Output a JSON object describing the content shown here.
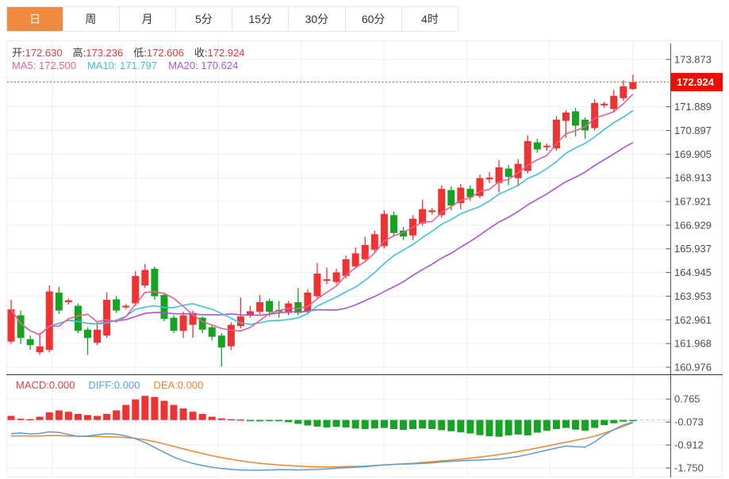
{
  "tabs": [
    {
      "label": "日",
      "selected": true
    },
    {
      "label": "周",
      "selected": false
    },
    {
      "label": "月",
      "selected": false
    },
    {
      "label": "5分",
      "selected": false
    },
    {
      "label": "15分",
      "selected": false
    },
    {
      "label": "30分",
      "selected": false
    },
    {
      "label": "60分",
      "selected": false
    },
    {
      "label": "4时",
      "selected": false
    }
  ],
  "main_overlay": {
    "ohlc": [
      {
        "label": "开:",
        "value": "172.630"
      },
      {
        "label": "高:",
        "value": "173.236"
      },
      {
        "label": "低:",
        "value": "172.606"
      },
      {
        "label": "收:",
        "value": "172.924"
      }
    ],
    "ma": [
      "MA5: 172.500",
      "MA10: 171.797",
      "MA20: 170.624"
    ]
  },
  "macd_overlay": [
    "MACD:0.000",
    "DIFF:0.000",
    "DEA:0.000"
  ],
  "price_tag": "172.924",
  "colors": {
    "up": "#ef3232",
    "down": "#16a321",
    "ma5": "#e8618f",
    "ma10": "#3cc3da",
    "ma20": "#ab53d5",
    "diff": "#5b9bd5",
    "dea": "#f0862b",
    "tag_bg": "#eb0f00",
    "tab_selected": "#f08a3e",
    "grid": "#e9eef5",
    "axis": "#555555",
    "dotted_price_line": "#f04040",
    "macd_zero_dashed": "#9fd0ef"
  },
  "chart_data": {
    "type": "candlestick+macd",
    "timeframe_selected": "日",
    "current_price": 172.924,
    "price_axis": {
      "ticks": [
        173.873,
        171.889,
        170.897,
        169.905,
        168.913,
        167.921,
        166.929,
        165.937,
        164.945,
        163.953,
        162.961,
        161.968,
        160.976
      ]
    },
    "macd_axis": {
      "ticks": [
        0.765,
        -0.073,
        -0.912,
        -1.75
      ]
    },
    "candle_format": [
      "open",
      "close",
      "high",
      "low"
    ],
    "candles": [
      [
        162.05,
        163.4,
        163.8,
        161.95
      ],
      [
        163.15,
        162.2,
        163.35,
        161.95
      ],
      [
        162.15,
        161.9,
        162.3,
        161.7
      ],
      [
        161.6,
        161.85,
        162.4,
        161.5
      ],
      [
        161.7,
        164.15,
        164.4,
        161.6
      ],
      [
        164.1,
        163.35,
        164.35,
        163.2
      ],
      [
        163.7,
        163.78,
        163.85,
        163.6
      ],
      [
        163.55,
        162.5,
        163.65,
        162.4
      ],
      [
        162.55,
        162.2,
        162.65,
        161.5
      ],
      [
        162.0,
        162.55,
        162.9,
        161.9
      ],
      [
        162.3,
        163.8,
        164.1,
        162.2
      ],
      [
        163.82,
        163.35,
        163.95,
        163.25
      ],
      [
        163.48,
        163.55,
        163.62,
        163.4
      ],
      [
        163.65,
        164.8,
        165.0,
        163.55
      ],
      [
        164.4,
        165.05,
        165.3,
        164.3
      ],
      [
        165.1,
        163.95,
        165.2,
        163.8
      ],
      [
        164.0,
        163.0,
        164.1,
        162.9
      ],
      [
        163.05,
        162.5,
        163.15,
        162.4
      ],
      [
        162.5,
        163.15,
        163.3,
        162.2
      ],
      [
        162.75,
        163.25,
        163.35,
        162.2
      ],
      [
        163.05,
        162.55,
        163.1,
        162.4
      ],
      [
        162.65,
        162.25,
        162.75,
        162.1
      ],
      [
        162.3,
        161.8,
        162.4,
        161.0
      ],
      [
        161.85,
        162.75,
        162.85,
        161.7
      ],
      [
        162.7,
        163.1,
        163.9,
        162.6
      ],
      [
        163.15,
        163.32,
        163.55,
        163.05
      ],
      [
        163.3,
        163.7,
        164.0,
        163.2
      ],
      [
        163.75,
        163.3,
        163.85,
        163.1
      ],
      [
        163.38,
        163.3,
        163.75,
        163.05
      ],
      [
        163.25,
        163.65,
        163.75,
        163.15
      ],
      [
        163.7,
        163.25,
        164.3,
        163.15
      ],
      [
        163.3,
        164.1,
        164.25,
        163.2
      ],
      [
        163.95,
        164.9,
        165.35,
        163.85
      ],
      [
        164.6,
        164.66,
        165.15,
        164.45
      ],
      [
        164.55,
        164.95,
        165.1,
        164.45
      ],
      [
        164.8,
        165.5,
        165.65,
        164.7
      ],
      [
        165.2,
        165.75,
        166.0,
        165.1
      ],
      [
        165.5,
        166.1,
        166.45,
        165.4
      ],
      [
        165.9,
        166.55,
        166.7,
        165.8
      ],
      [
        166.05,
        167.4,
        167.55,
        165.95
      ],
      [
        167.35,
        166.6,
        167.5,
        166.45
      ],
      [
        166.7,
        166.45,
        166.85,
        166.3
      ],
      [
        166.5,
        167.2,
        167.35,
        166.3
      ],
      [
        167.0,
        167.6,
        168.0,
        166.9
      ],
      [
        167.48,
        167.55,
        167.65,
        167.38
      ],
      [
        167.35,
        168.45,
        168.6,
        167.25
      ],
      [
        168.4,
        167.75,
        168.55,
        167.55
      ],
      [
        167.85,
        168.5,
        168.65,
        167.6
      ],
      [
        168.45,
        168.1,
        168.6,
        167.95
      ],
      [
        168.15,
        168.9,
        169.05,
        168.05
      ],
      [
        168.85,
        168.92,
        169.15,
        168.7
      ],
      [
        168.7,
        169.35,
        169.65,
        168.3
      ],
      [
        169.3,
        168.95,
        169.45,
        168.6
      ],
      [
        168.9,
        169.5,
        169.7,
        168.55
      ],
      [
        169.2,
        170.45,
        170.7,
        169.1
      ],
      [
        170.4,
        170.1,
        170.55,
        169.95
      ],
      [
        170.2,
        170.26,
        170.35,
        170.05
      ],
      [
        170.15,
        171.35,
        171.5,
        170.05
      ],
      [
        171.3,
        171.65,
        171.75,
        170.6
      ],
      [
        171.7,
        171.1,
        171.85,
        170.65
      ],
      [
        171.35,
        170.9,
        171.45,
        170.55
      ],
      [
        171.0,
        172.05,
        172.2,
        170.9
      ],
      [
        171.95,
        172.02,
        172.1,
        171.85
      ],
      [
        171.8,
        172.35,
        172.6,
        171.7
      ],
      [
        172.25,
        172.75,
        173.0,
        172.15
      ],
      [
        172.63,
        172.924,
        173.236,
        172.606
      ]
    ],
    "ma_periods": [
      5,
      10,
      20
    ],
    "macd_hist": [
      0.15,
      0.05,
      0.03,
      0.12,
      0.28,
      0.35,
      0.3,
      0.22,
      0.18,
      0.15,
      0.22,
      0.35,
      0.55,
      0.75,
      0.88,
      0.84,
      0.7,
      0.55,
      0.42,
      0.3,
      0.22,
      0.12,
      0.06,
      0.03,
      0.02,
      -0.03,
      -0.05,
      -0.04,
      -0.03,
      -0.08,
      -0.14,
      -0.2,
      -0.24,
      -0.27,
      -0.25,
      -0.27,
      -0.31,
      -0.33,
      -0.31,
      -0.29,
      -0.33,
      -0.36,
      -0.33,
      -0.31,
      -0.33,
      -0.37,
      -0.41,
      -0.45,
      -0.49,
      -0.55,
      -0.59,
      -0.61,
      -0.56,
      -0.53,
      -0.56,
      -0.46,
      -0.39,
      -0.33,
      -0.29,
      -0.35,
      -0.39,
      -0.29,
      -0.19,
      -0.12,
      -0.06,
      -0.02
    ],
    "diff_line": [
      -0.5,
      -0.47,
      -0.51,
      -0.49,
      -0.43,
      -0.45,
      -0.53,
      -0.6,
      -0.58,
      -0.54,
      -0.5,
      -0.52,
      -0.58,
      -0.68,
      -0.82,
      -1.0,
      -1.18,
      -1.35,
      -1.48,
      -1.58,
      -1.66,
      -1.72,
      -1.77,
      -1.8,
      -1.82,
      -1.83,
      -1.83,
      -1.82,
      -1.81,
      -1.81,
      -1.82,
      -1.81,
      -1.8,
      -1.78,
      -1.76,
      -1.74,
      -1.72,
      -1.7,
      -1.67,
      -1.64,
      -1.62,
      -1.61,
      -1.6,
      -1.58,
      -1.56,
      -1.53,
      -1.51,
      -1.49,
      -1.47,
      -1.46,
      -1.44,
      -1.42,
      -1.38,
      -1.33,
      -1.26,
      -1.18,
      -1.1,
      -1.02,
      -0.95,
      -0.97,
      -0.99,
      -0.8,
      -0.55,
      -0.35,
      -0.18,
      -0.08
    ],
    "dea_line": [
      -0.58,
      -0.58,
      -0.58,
      -0.58,
      -0.57,
      -0.57,
      -0.58,
      -0.59,
      -0.6,
      -0.6,
      -0.61,
      -0.62,
      -0.64,
      -0.67,
      -0.72,
      -0.79,
      -0.87,
      -0.96,
      -1.05,
      -1.14,
      -1.22,
      -1.3,
      -1.37,
      -1.43,
      -1.49,
      -1.54,
      -1.58,
      -1.61,
      -1.64,
      -1.66,
      -1.68,
      -1.7,
      -1.71,
      -1.71,
      -1.71,
      -1.7,
      -1.69,
      -1.68,
      -1.66,
      -1.64,
      -1.62,
      -1.6,
      -1.58,
      -1.55,
      -1.52,
      -1.49,
      -1.46,
      -1.43,
      -1.39,
      -1.35,
      -1.31,
      -1.26,
      -1.21,
      -1.15,
      -1.09,
      -1.02,
      -0.95,
      -0.88,
      -0.81,
      -0.74,
      -0.67,
      -0.59,
      -0.48,
      -0.36,
      -0.23,
      -0.1
    ]
  }
}
